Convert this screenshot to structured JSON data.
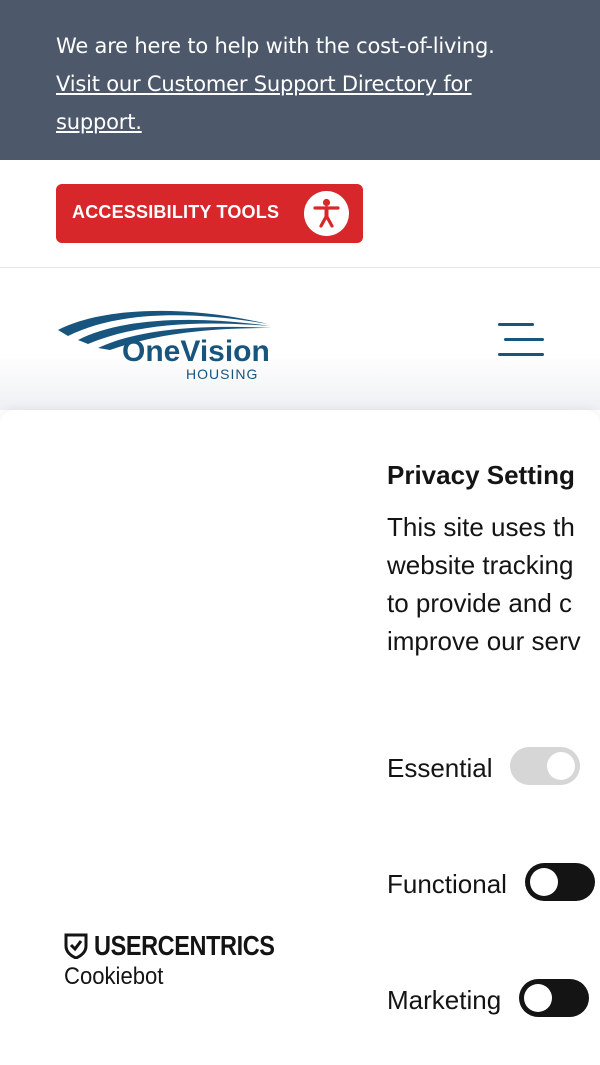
{
  "banner": {
    "text": "We are here to help with the cost-of-living.",
    "link_line1": "Visit our Customer Support Directory for",
    "link_line2": "support."
  },
  "accessibility": {
    "button_label": "ACCESSIBILITY TOOLS",
    "icon": "accessibility-person-icon",
    "color": "#d7272b"
  },
  "header": {
    "logo_name": "OneVision",
    "logo_sub": "HOUSING",
    "menu_icon": "hamburger-menu-icon",
    "brand_color": "#17557f"
  },
  "consent": {
    "brand_top": "USERCENTRICS",
    "brand_bottom": "Cookiebot",
    "title": "Privacy Setting",
    "text_lines": [
      "This site uses th",
      "website tracking",
      "to provide and c",
      "improve our serv"
    ],
    "toggles": [
      {
        "label": "Essential",
        "state": "on-disabled"
      },
      {
        "label": "Functional",
        "state": "off"
      },
      {
        "label": "Marketing",
        "state": "off"
      }
    ]
  },
  "colors": {
    "banner_bg": "#4d596b"
  }
}
